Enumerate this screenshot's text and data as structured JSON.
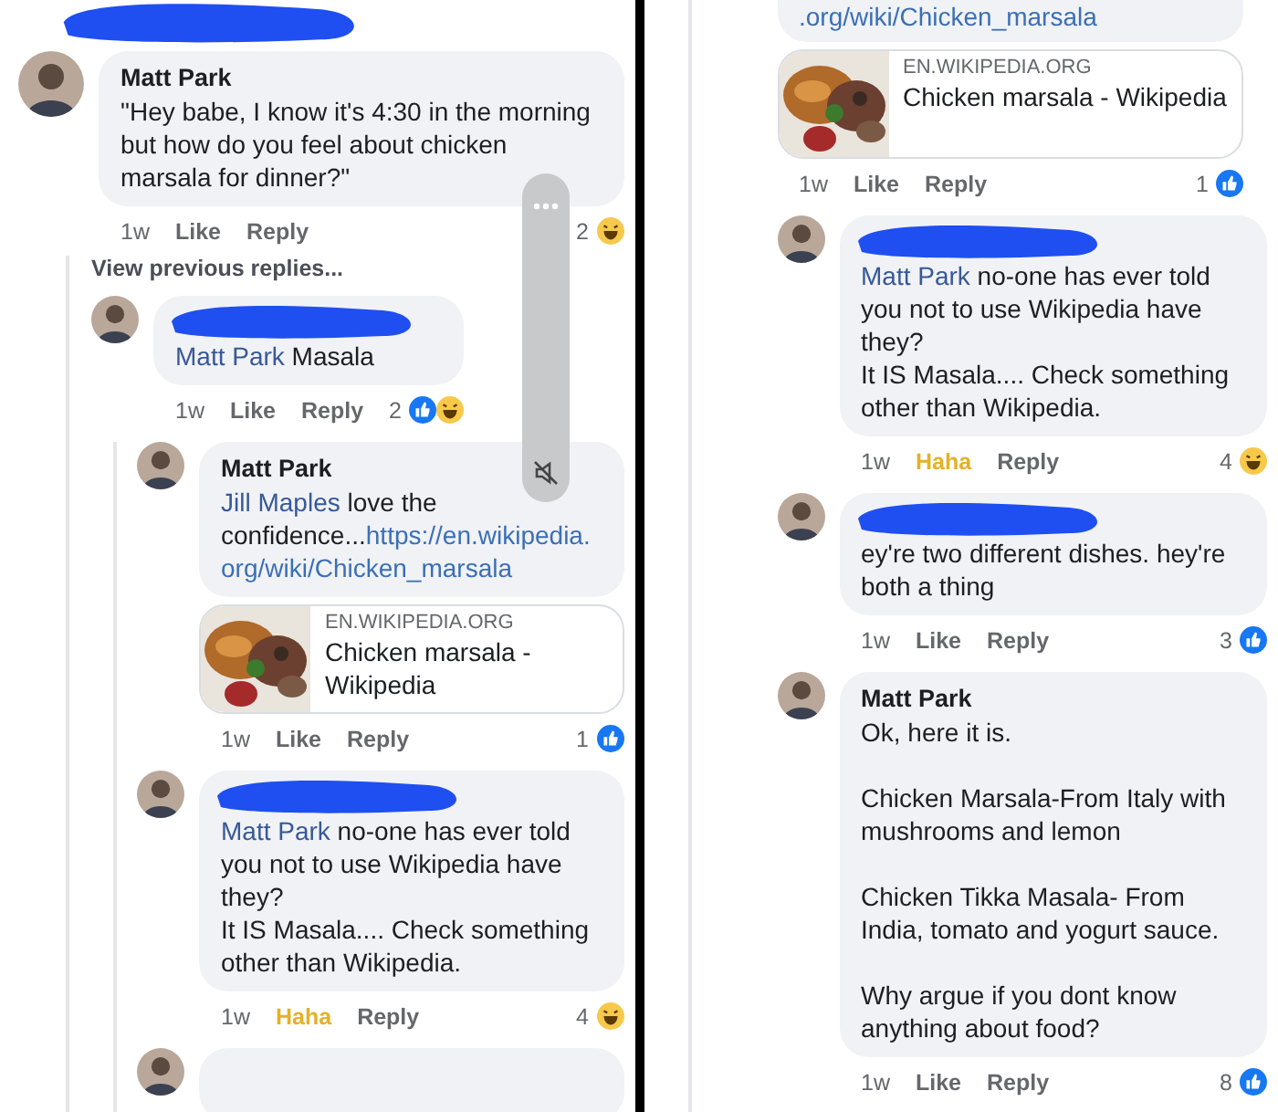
{
  "panels": [
    {
      "top_redaction": true,
      "overlay": {
        "visible": true
      },
      "comments": [
        {
          "kind": "comment",
          "author": "Matt Park",
          "body": [
            {
              "text": "\"Hey babe, I know it's 4:30 in the morning but how do you feel about chicken marsala for dinner?\""
            }
          ],
          "time": "1w",
          "react": {
            "label": "Like",
            "selected": false
          },
          "reply": "Reply",
          "count": "2",
          "reactions": [
            {
              "kind": "haha"
            }
          ],
          "children": [
            {
              "kind": "more",
              "label": "View previous replies..."
            },
            {
              "kind": "comment",
              "redacted": true,
              "body": [
                {
                  "text": "Matt Park",
                  "kind": "mention"
                },
                {
                  "text": " Masala"
                }
              ],
              "time": "1w",
              "react": {
                "label": "Like",
                "selected": false
              },
              "reply": "Reply",
              "count": "2",
              "reactions": [
                {
                  "kind": "like"
                },
                {
                  "kind": "haha"
                }
              ],
              "children": [
                {
                  "kind": "comment",
                  "author": "Matt Park",
                  "body": [
                    {
                      "text": "Jill Maples",
                      "kind": "mention"
                    },
                    {
                      "text": " love the confidence..."
                    },
                    {
                      "text": "https://en.wikipedia.org/wiki/Chicken_marsala",
                      "kind": "link"
                    }
                  ],
                  "preview": {
                    "site": "EN.WIKIPEDIA.ORG",
                    "title": "Chicken marsala - Wikipedia"
                  },
                  "time": "1w",
                  "react": {
                    "label": "Like",
                    "selected": false
                  },
                  "reply": "Reply",
                  "count": "1",
                  "reactions": [
                    {
                      "kind": "like"
                    }
                  ]
                },
                {
                  "kind": "comment",
                  "redacted": true,
                  "body": [
                    {
                      "text": "Matt Park",
                      "kind": "mention"
                    },
                    {
                      "text": " no-one has ever told you not to use Wikipedia have they?\nIt IS Masala.... Check something other than Wikipedia."
                    }
                  ],
                  "time": "1w",
                  "react": {
                    "label": "Haha",
                    "selected": true
                  },
                  "reply": "Reply",
                  "count": "4",
                  "reactions": [
                    {
                      "kind": "haha"
                    }
                  ]
                },
                {
                  "kind": "cut"
                }
              ]
            }
          ]
        }
      ]
    },
    {
      "comments": [
        {
          "kind": "fragment",
          "body": [
            {
              "text": ".org/wiki/Chicken_marsala",
              "kind": "link"
            }
          ],
          "preview": {
            "site": "EN.WIKIPEDIA.ORG",
            "title": "Chicken marsala - Wikipedia"
          },
          "time": "1w",
          "react": {
            "label": "Like",
            "selected": false
          },
          "reply": "Reply",
          "count": "1",
          "reactions": [
            {
              "kind": "like"
            }
          ]
        },
        {
          "kind": "comment",
          "redacted": true,
          "body": [
            {
              "text": "Matt Park",
              "kind": "mention"
            },
            {
              "text": " no-one has ever told you not to use Wikipedia have they?\nIt IS Masala.... Check something other than Wikipedia."
            }
          ],
          "time": "1w",
          "react": {
            "label": "Haha",
            "selected": true
          },
          "reply": "Reply",
          "count": "4",
          "reactions": [
            {
              "kind": "haha"
            }
          ]
        },
        {
          "kind": "comment",
          "redacted": true,
          "body": [
            {
              "text": "ey're two different dishes. hey're both a thing"
            }
          ],
          "time": "1w",
          "react": {
            "label": "Like",
            "selected": false
          },
          "reply": "Reply",
          "count": "3",
          "reactions": [
            {
              "kind": "like"
            }
          ]
        },
        {
          "kind": "comment",
          "author": "Matt Park",
          "body": [
            {
              "text": "Ok, here it is.\n\nChicken Marsala-From Italy with mushrooms and lemon\n\nChicken Tikka Masala- From India, tomato and yogurt sauce.\n\nWhy argue if you dont know anything about food?"
            }
          ],
          "time": "1w",
          "react": {
            "label": "Like",
            "selected": false
          },
          "reply": "Reply",
          "count": "8",
          "reactions": [
            {
              "kind": "like"
            }
          ]
        }
      ]
    }
  ]
}
